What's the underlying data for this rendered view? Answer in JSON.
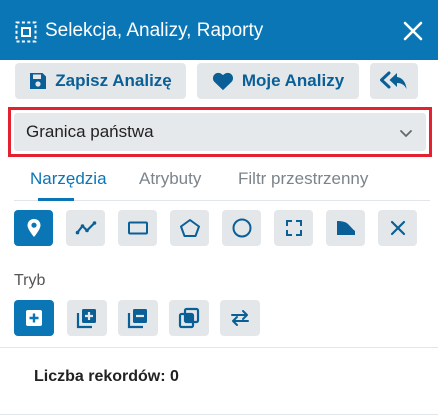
{
  "header": {
    "title": "Selekcja, Analizy, Raporty",
    "icon": "selection-icon",
    "close_icon": "close-icon",
    "background": "#0a76b5"
  },
  "actions": {
    "save_label": "Zapisz Analizę",
    "my_label": "Moje Analizy",
    "back_icon": "reply-all-icon"
  },
  "layer_select": {
    "value": "Granica państwa",
    "highlight_color": "#e3212f"
  },
  "tabs": [
    {
      "label": "Narzędzia",
      "active": true
    },
    {
      "label": "Atrybuty",
      "active": false
    },
    {
      "label": "Filtr przestrzenny",
      "active": false
    }
  ],
  "tools": [
    {
      "name": "point-tool",
      "active": true
    },
    {
      "name": "polyline-tool",
      "active": false
    },
    {
      "name": "rectangle-tool",
      "active": false
    },
    {
      "name": "polygon-tool",
      "active": false
    },
    {
      "name": "circle-tool",
      "active": false
    },
    {
      "name": "extent-tool",
      "active": false
    },
    {
      "name": "freehand-tool",
      "active": false
    },
    {
      "name": "clear-tool",
      "active": false
    }
  ],
  "mode": {
    "label": "Tryb",
    "options": [
      {
        "name": "new-selection-mode",
        "active": true
      },
      {
        "name": "add-to-selection-mode",
        "active": false
      },
      {
        "name": "remove-from-selection-mode",
        "active": false
      },
      {
        "name": "intersect-selection-mode",
        "active": false
      },
      {
        "name": "swap-selection-mode",
        "active": false
      }
    ]
  },
  "records": {
    "text": "Liczba rekordów: 0"
  },
  "colors": {
    "accent": "#0a76b5",
    "button_bg": "#e4e7ea"
  }
}
